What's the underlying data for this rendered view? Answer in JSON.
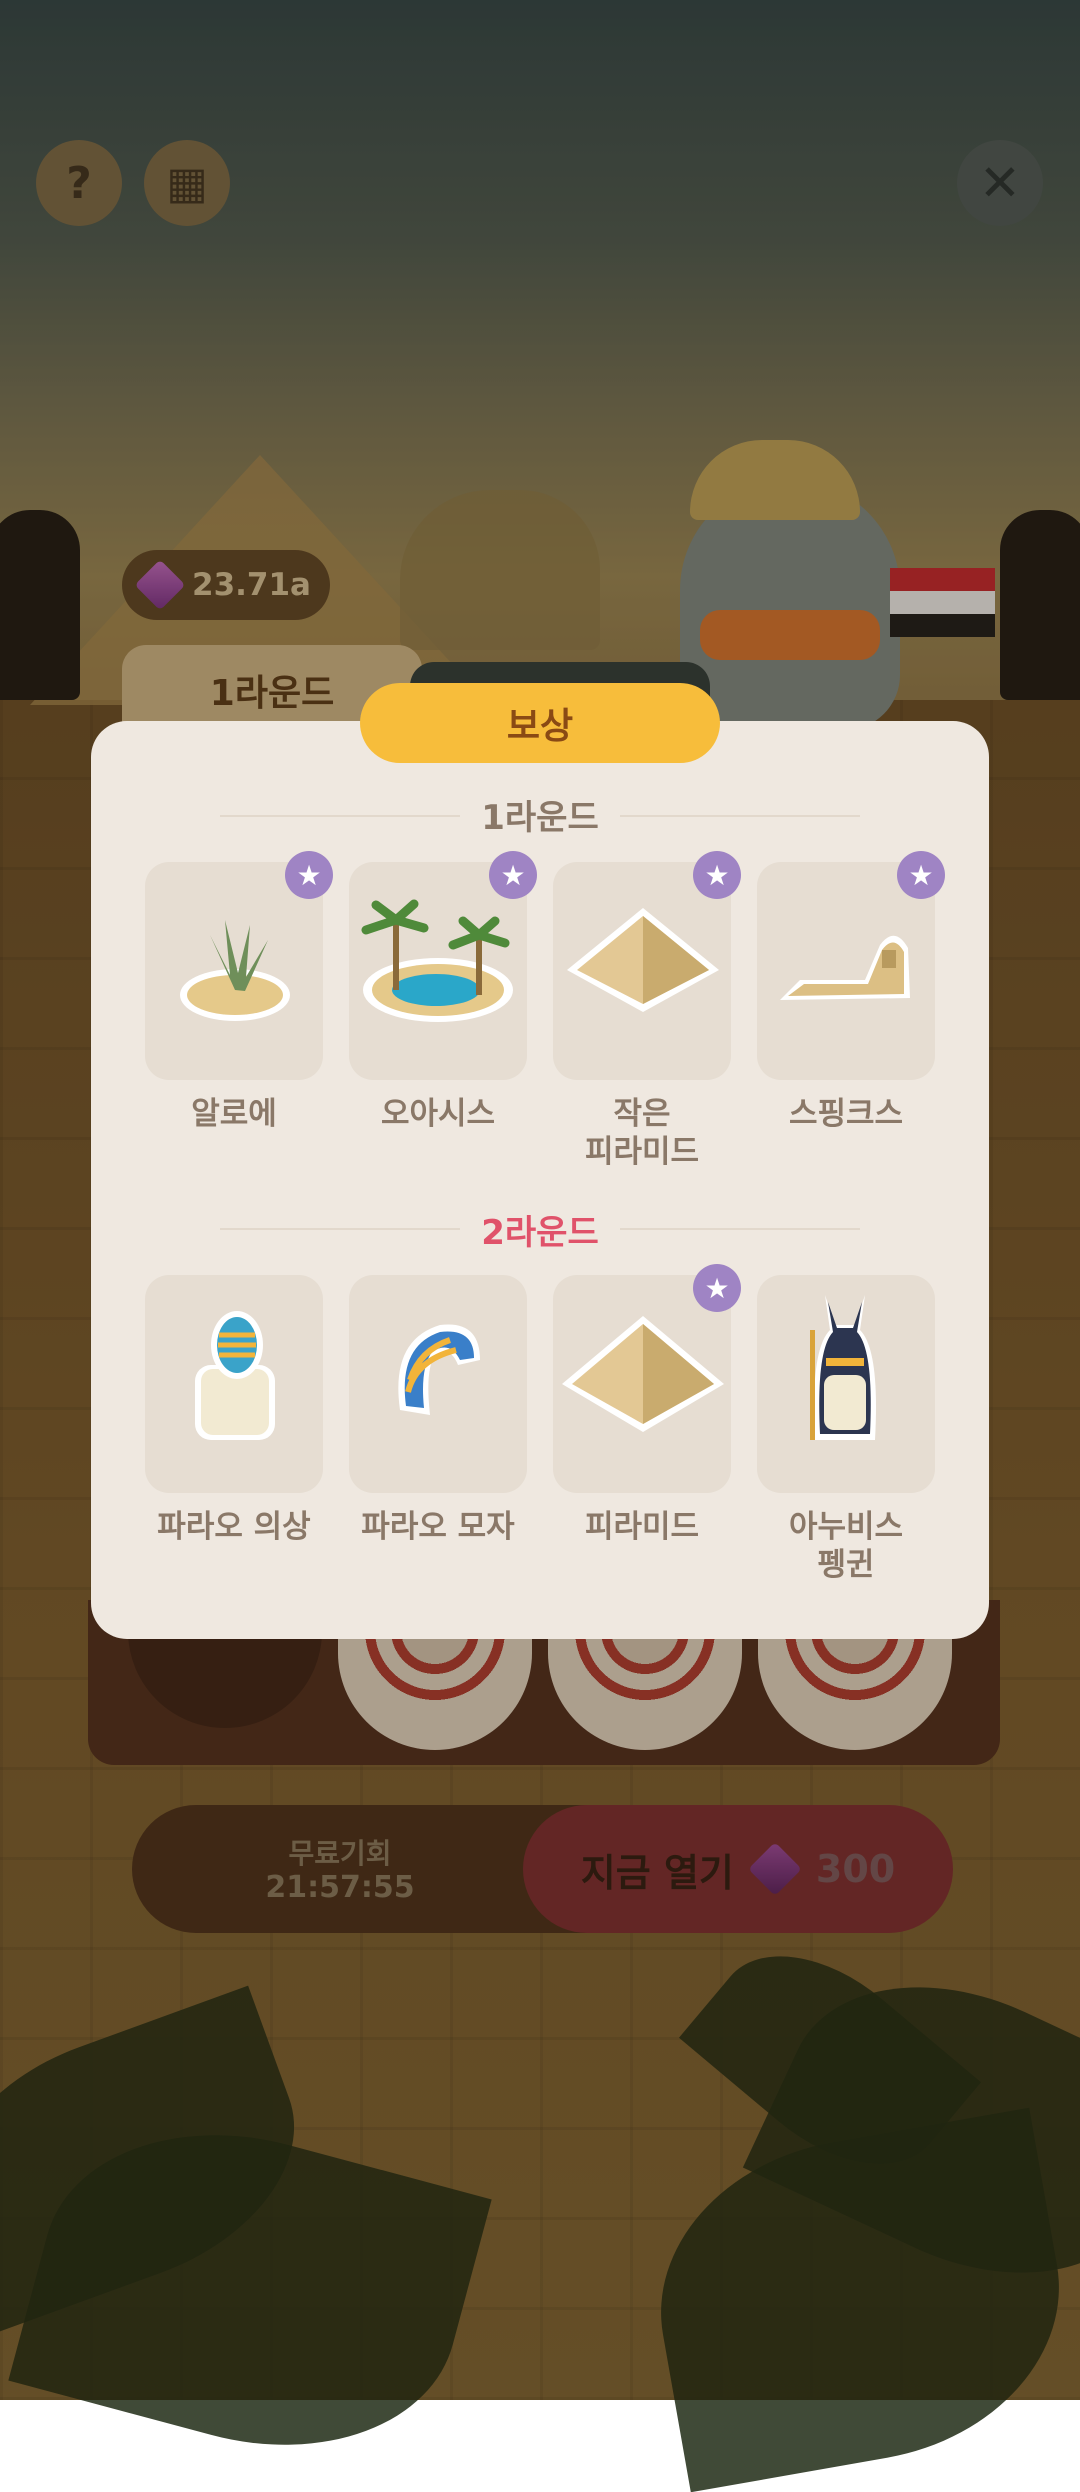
{
  "top_bar": {
    "help_icon": "question-icon",
    "help_glyph": "?",
    "grid_icon": "grid-icon",
    "grid_glyph": "▦",
    "close_icon": "close-icon",
    "close_glyph": "✕"
  },
  "currency": {
    "gem_icon": "gem-icon",
    "amount": "23.71a"
  },
  "tabs": {
    "left_label": "1라운드"
  },
  "modal": {
    "title": "보상",
    "rounds": [
      {
        "label": "1라운드",
        "color": "#8a7868",
        "items": [
          {
            "label": "알로에",
            "starred": true
          },
          {
            "label": "오아시스",
            "starred": true
          },
          {
            "label": "작은 피라미드",
            "line1": "작은",
            "line2": "피라미드",
            "starred": true
          },
          {
            "label": "스핑크스",
            "starred": true
          }
        ]
      },
      {
        "label": "2라운드",
        "color": "#e0526a",
        "items": [
          {
            "label": "파라오 의상",
            "starred": false
          },
          {
            "label": "파라오 모자",
            "starred": false
          },
          {
            "label": "피라미드",
            "starred": true
          },
          {
            "label": "아누비스 펭귄",
            "line1": "아누비스",
            "line2": "펭귄",
            "starred": false
          }
        ]
      }
    ],
    "star_glyph": "★"
  },
  "bottom": {
    "free_label": "무료기회",
    "free_timer": "21:57:55",
    "open_label": "지금 열기",
    "open_price": "300"
  },
  "colors": {
    "accent": "#f7bd3b",
    "badge": "#9f84c4",
    "round2": "#e0526a"
  }
}
